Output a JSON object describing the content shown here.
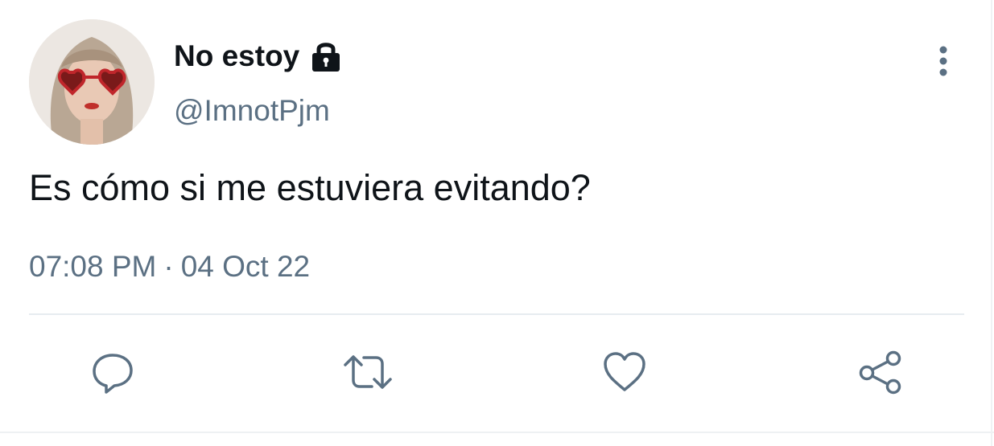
{
  "tweet": {
    "display_name": "No estoy",
    "handle": "@ImnotPjm",
    "text": "Es cómo si me estuviera evitando?",
    "time": "07:08 PM",
    "separator": "·",
    "date": "04 Oct 22",
    "protected_icon": "lock-icon",
    "avatar": "profile-photo-heart-sunglasses"
  },
  "actions": [
    {
      "name": "reply",
      "icon": "comment-bubble-icon"
    },
    {
      "name": "retweet",
      "icon": "retweet-arrows-icon"
    },
    {
      "name": "like",
      "icon": "heart-icon"
    },
    {
      "name": "share",
      "icon": "share-nodes-icon"
    }
  ],
  "menu": {
    "icon": "vertical-dots-icon"
  },
  "colors": {
    "text_primary": "#0f1419",
    "text_secondary": "#5b7083",
    "icon_gray": "#5b7083",
    "divider": "#e6ecf0",
    "background": "#ffffff"
  }
}
